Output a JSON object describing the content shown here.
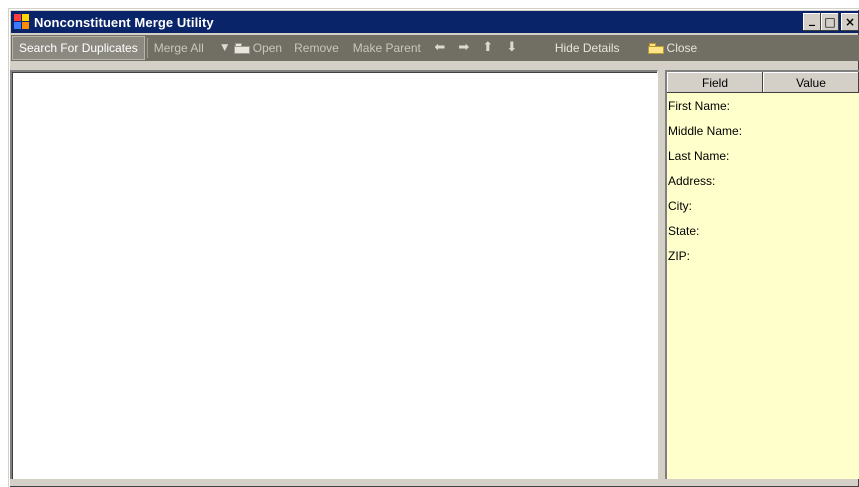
{
  "window": {
    "title": "Nonconstituent Merge Utility",
    "controls": {
      "minimize": "_",
      "maximize": "□",
      "close": "×"
    }
  },
  "toolbar": {
    "search_label": "Search For Duplicates",
    "merge_all_label": "Merge All",
    "open_label": "Open",
    "remove_label": "Remove",
    "make_parent_label": "Make Parent",
    "hide_details_label": "Hide Details",
    "close_label": "Close",
    "icons": [
      "dropdown-arrow-icon",
      "open-folder-icon",
      "arrow-left-icon",
      "arrow-right-icon",
      "arrow-up-icon",
      "arrow-down-icon",
      "close-folder-icon"
    ]
  },
  "details": {
    "columns": [
      "Field",
      "Value"
    ],
    "rows": [
      {
        "field": "First Name:",
        "value": ""
      },
      {
        "field": "Middle Name:",
        "value": ""
      },
      {
        "field": "Last Name:",
        "value": ""
      },
      {
        "field": "Address:",
        "value": ""
      },
      {
        "field": "City:",
        "value": ""
      },
      {
        "field": "State:",
        "value": ""
      },
      {
        "field": "ZIP:",
        "value": ""
      }
    ]
  },
  "colors": {
    "titlebar": "#0a246a",
    "toolbar": "#716f64",
    "detail_background": "#ffffcc",
    "window_face": "#d4d0c8"
  }
}
